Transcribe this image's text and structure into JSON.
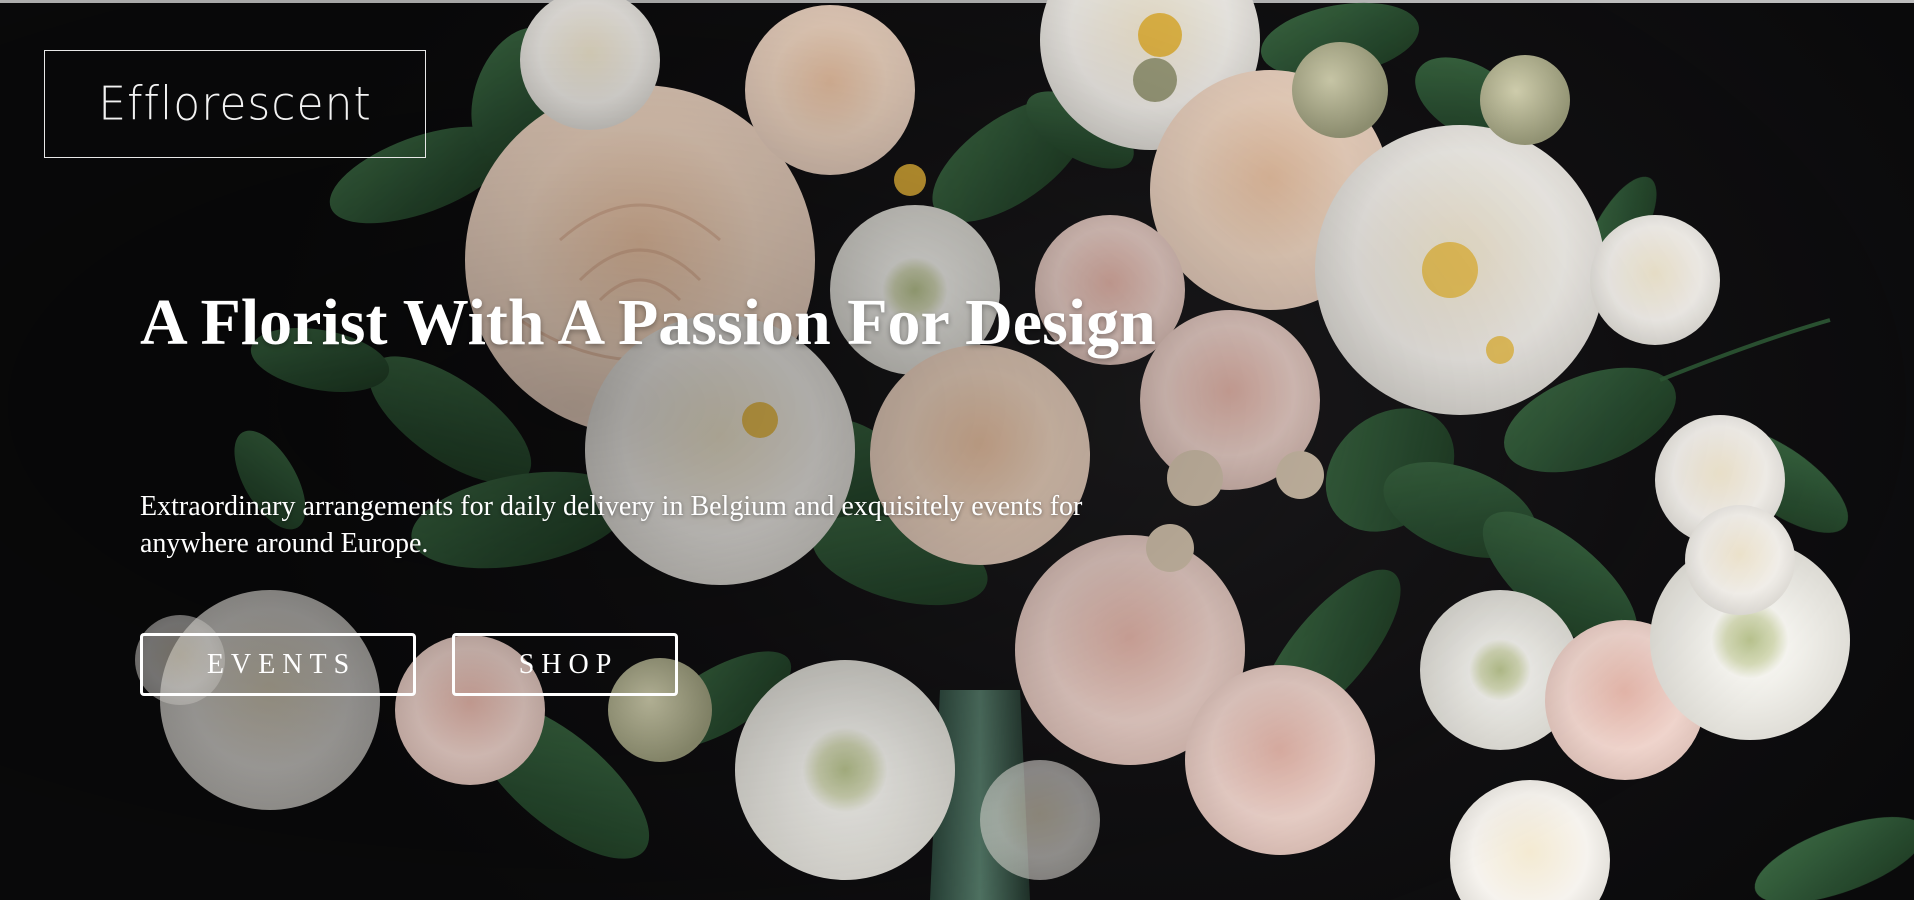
{
  "brand": {
    "logo_text": "Efflorescent"
  },
  "hero": {
    "headline": "A Florist With A Passion For Design",
    "subtitle": "Extraordinary arrangements for daily delivery in Belgium and exquisitely events for anywhere around Europe."
  },
  "actions": {
    "events_label": "EVENTS",
    "shop_label": "SHOP"
  },
  "colors": {
    "background": "#0d0c0d",
    "text": "#ffffff",
    "rose_peach": "#f2d3bd",
    "rose_blush": "#edd0ca",
    "petal_white": "#f4f1ec",
    "leaf_green": "#2f5a36"
  }
}
